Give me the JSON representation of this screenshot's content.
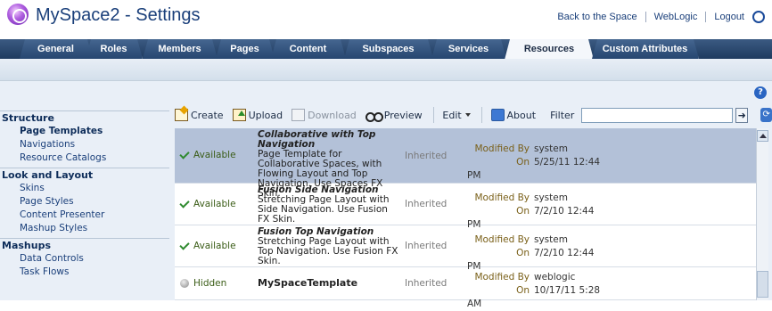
{
  "header": {
    "title": "MySpace2 - Settings",
    "links": [
      "Back to the Space",
      "WebLogic",
      "Logout"
    ]
  },
  "tabs": [
    "General",
    "Roles",
    "Members",
    "Pages",
    "Content",
    "Subspaces",
    "Services",
    "Resources",
    "Custom Attributes"
  ],
  "active_tab": "Resources",
  "sidebar": {
    "groups": [
      {
        "label": "Structure",
        "items": [
          "Page Templates",
          "Navigations",
          "Resource Catalogs"
        ]
      },
      {
        "label": "Look and Layout",
        "items": [
          "Skins",
          "Page Styles",
          "Content Presenter",
          "Mashup Styles"
        ]
      },
      {
        "label": "Mashups",
        "items": [
          "Data Controls",
          "Task Flows"
        ]
      }
    ],
    "selected_item": "Page Templates"
  },
  "toolbar": {
    "create": "Create",
    "upload": "Upload",
    "download": "Download",
    "preview": "Preview",
    "edit": "Edit",
    "about": "About",
    "filter_label": "Filter",
    "filter_value": ""
  },
  "table": {
    "rows": [
      {
        "status": "Available",
        "name": "Collaborative with Top Navigation",
        "desc": "Page Template for Collaborative Spaces, with Flowing Layout and Top Navigation. Use Spaces FX Skin.",
        "inherited": "Inherited",
        "modified_by_label": "Modified By",
        "modified_by": "system",
        "on_label": "On",
        "on": "5/25/11 12:44 PM"
      },
      {
        "status": "Available",
        "name": "Fusion Side Navigation",
        "desc": "Stretching Page Layout with Side Navigation. Use Fusion FX Skin.",
        "inherited": "Inherited",
        "modified_by_label": "Modified By",
        "modified_by": "system",
        "on_label": "On",
        "on": "7/2/10 12:44 PM"
      },
      {
        "status": "Available",
        "name": "Fusion Top Navigation",
        "desc": "Stretching Page Layout with Top Navigation. Use Fusion FX Skin.",
        "inherited": "Inherited",
        "modified_by_label": "Modified By",
        "modified_by": "system",
        "on_label": "On",
        "on": "7/2/10 12:44 PM"
      },
      {
        "status": "Hidden",
        "name": "MySpaceTemplate",
        "desc": "",
        "inherited": "Inherited",
        "modified_by_label": "Modified By",
        "modified_by": "weblogic",
        "on_label": "On",
        "on": "10/17/11 5:28 AM"
      }
    ]
  },
  "colors": {
    "accent": "#1f3b5f",
    "selected_row": "#b3c1d8",
    "available": "#2f8a2f"
  }
}
